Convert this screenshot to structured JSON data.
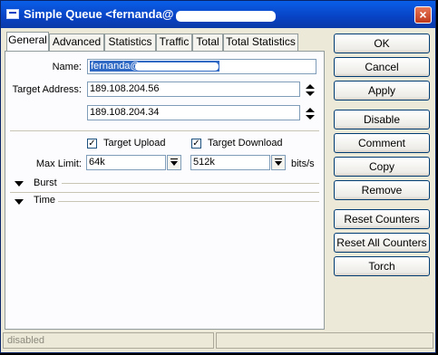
{
  "window": {
    "title": "Simple Queue <fernanda@",
    "close_glyph": "×"
  },
  "tabs": [
    "General",
    "Advanced",
    "Statistics",
    "Traffic",
    "Total",
    "Total Statistics"
  ],
  "general": {
    "name_label": "Name:",
    "name_value": "fernanda@",
    "target_label": "Target Address:",
    "target_1": "189.108.204.56",
    "target_2": "189.108.204.34",
    "target_upload_label": "Target Upload",
    "target_download_label": "Target Download",
    "target_upload_checked": true,
    "target_download_checked": true,
    "max_limit_label": "Max Limit:",
    "max_limit_upload": "64k",
    "max_limit_download": "512k",
    "units": "bits/s",
    "burst_label": "Burst",
    "time_label": "Time"
  },
  "buttons": [
    "OK",
    "Cancel",
    "Apply",
    "Disable",
    "Comment",
    "Copy",
    "Remove",
    "Reset Counters",
    "Reset All Counters",
    "Torch"
  ],
  "status": {
    "state": "disabled"
  },
  "colors": {
    "title_bar": "#0842c4",
    "selection": "#316ac5",
    "dialog_bg": "#ece9d8"
  }
}
